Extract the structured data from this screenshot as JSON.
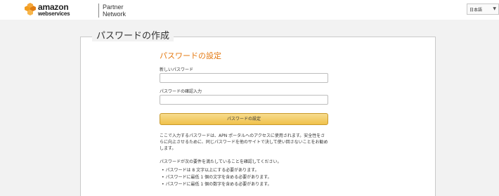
{
  "header": {
    "logo_amazon": "amazon",
    "logo_webservices": "webservices",
    "partner_line1": "Partner",
    "partner_line2": "Network",
    "language": "日本語"
  },
  "panel": {
    "title": "パスワードの作成",
    "section_title": "パスワードの設定",
    "new_password_label": "新しいパスワード",
    "new_password_value": "",
    "confirm_label": "パスワードの確認入力",
    "confirm_value": "",
    "submit_label": "パスワードの設定",
    "notice": "ここで入力するパスワードは、APN ポータルへのアクセスに使用されます。安全性をさらに向上させるために、同じパスワードを他のサイトで決して使い回さないことをお勧めします。",
    "requirements_intro": "パスワードが次の要件を満たしていることを確認してください。",
    "requirements": [
      "パスワードは 8 文字以上にする必要があります。",
      "パスワードに最低 1 個の文字を含める必要があります。",
      "パスワードに最低 1 個の数字を含める必要があります。"
    ]
  },
  "colors": {
    "accent_orange": "#e47911",
    "button_yellow": "#f0c14b",
    "aws_cube_orange": "#f29d1f"
  }
}
